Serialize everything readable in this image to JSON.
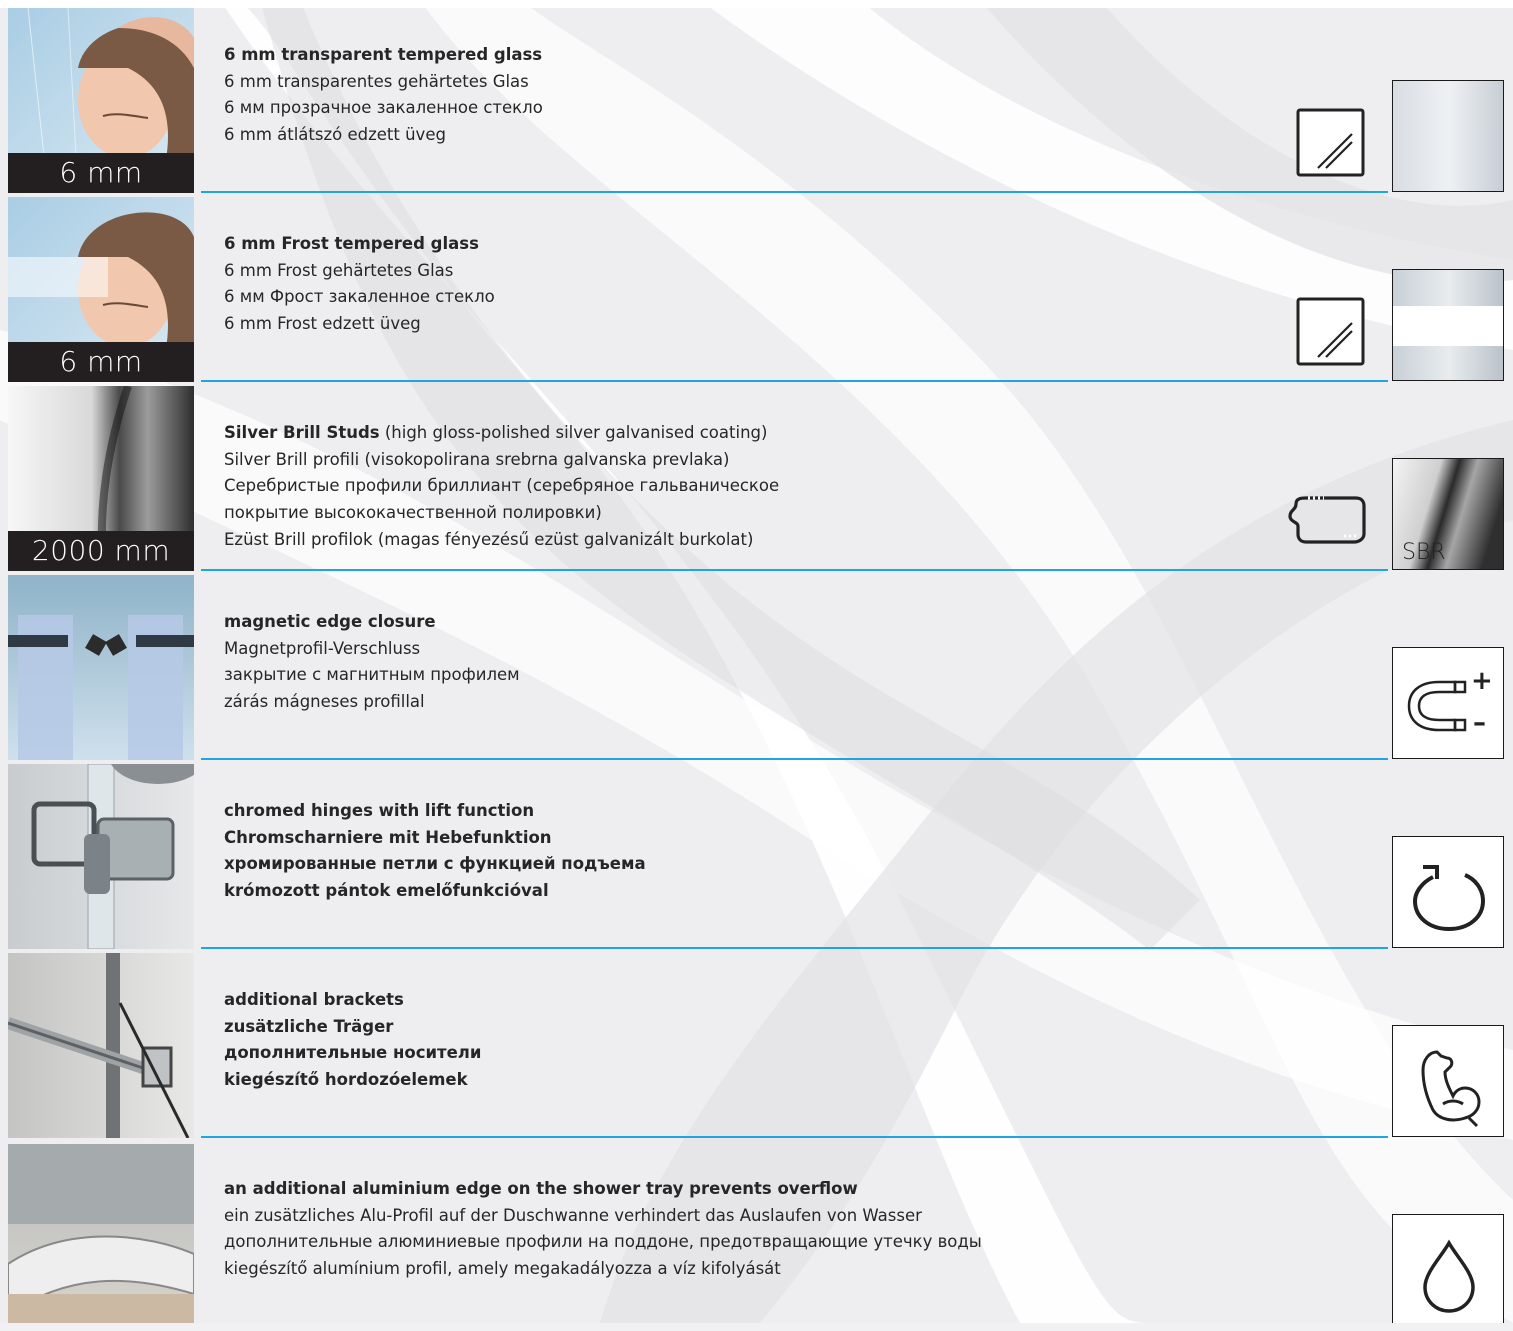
{
  "rows": [
    {
      "thumb_label": "6 mm",
      "bold_line": "6 mm transparent tempered glass",
      "lines": [
        "6 mm transparentes gehärtetes Glas",
        "6 мм прозрачное закаленное стекло",
        "6 mm átlátszó edzett üveg"
      ],
      "icon": "glass-panel-icon",
      "swatch_icon": "clear-glass-swatch"
    },
    {
      "thumb_label": "6 mm",
      "bold_line": "6 mm Frost tempered glass",
      "lines": [
        "6 mm Frost gehärtetes Glas",
        "6 мм Фрост закаленное стекло",
        "6 mm Frost edzett üveg"
      ],
      "icon": "glass-panel-icon",
      "swatch_icon": "frost-glass-swatch"
    },
    {
      "thumb_label": "2000 mm",
      "bold_line": "Silver Brill Studs",
      "bold_line_rest": " (high gloss-polished silver galvanised coating)",
      "lines": [
        "Silver Brill profili (visokopolirana srebrna galvanska prevlaka)",
        "Серебристые профили бриллиант (серебряное гальваническое",
        "покрытие высококачественной полировки)",
        "Ezüst Brill profilok (magas fényezésű ezüst galvanizált burkolat)"
      ],
      "icon": "profile-bar-icon",
      "swatch_code": "SBR",
      "swatch_icon": "silver-profile-swatch"
    },
    {
      "bold_line": "magnetic edge closure",
      "lines": [
        "Magnetprofil-Verschluss",
        "закрытие с магнитным профилем",
        "zárás mágneses profillal"
      ],
      "swatch_icon": "magnet-icon",
      "swatch_plus": "+",
      "swatch_minus": "–"
    },
    {
      "all_bold": true,
      "lines": [
        "chromed hinges with lift function",
        "Chromscharniere mit Hebefunktion",
        "хромированные петли с функцией подъема",
        "krómozott pántok emelőfunkcióval"
      ],
      "swatch_icon": "rotate-icon"
    },
    {
      "all_bold": true,
      "lines": [
        "additional brackets",
        "zusätzliche Träger",
        "дополнительные носители",
        "kiegészítő hordozóelemek"
      ],
      "swatch_icon": "strength-arm-icon"
    },
    {
      "bold_line": "an additional aluminium edge on the shower tray prevents overflow",
      "lines": [
        "ein zusätzliches Alu-Profil auf der Duschwanne verhindert das Auslaufen von Wasser",
        "дополнительные алюминиевые профили на поддоне, предотвращающие утечку воды",
        "kiegészítő alumínium profil, amely megakadályozza a víz kifolyását"
      ],
      "swatch_icon": "water-drop-icon"
    }
  ],
  "colors": {
    "divider": "#1fa6e2",
    "label_bg": "#231f20"
  }
}
